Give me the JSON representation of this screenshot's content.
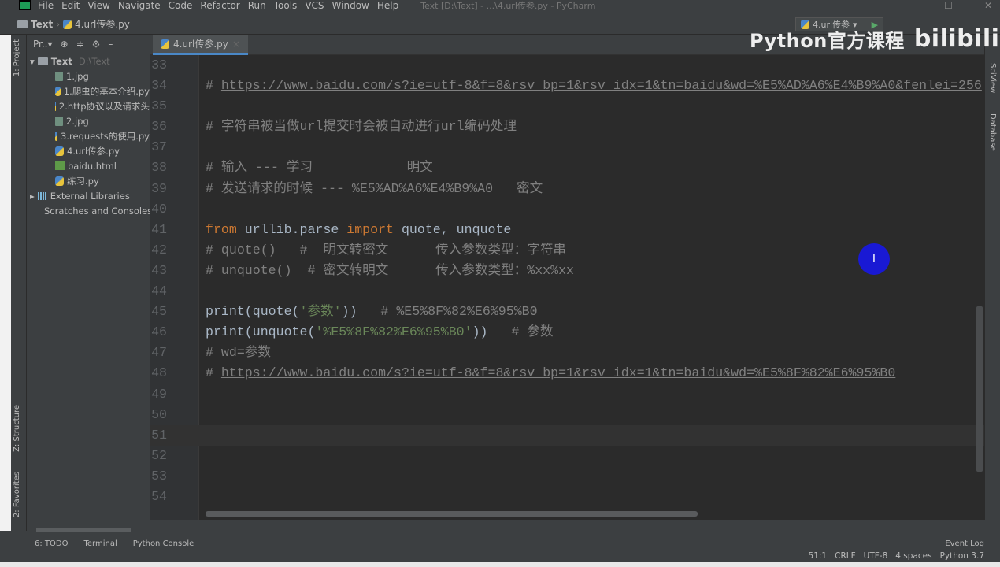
{
  "menu": [
    "File",
    "Edit",
    "View",
    "Navigate",
    "Code",
    "Refactor",
    "Run",
    "Tools",
    "VCS",
    "Window",
    "Help"
  ],
  "window_title": "Text [D:\\Text] - ...\\4.url传参.py - PyCharm",
  "breadcrumb": {
    "project": "Text",
    "file": "4.url传参.py"
  },
  "run_config": "4.url传参",
  "watermark": {
    "text": "Python官方课程",
    "logo": "bilibili"
  },
  "project_panel": {
    "dropdown": "Pr..",
    "root": "Text",
    "root_path": "D:\\Text",
    "files": [
      "1.jpg",
      "1.爬虫的基本介绍.py",
      "2.http协议以及请求头",
      "2.jpg",
      "3.requests的使用.py",
      "4.url传参.py",
      "baidu.html",
      "练习.py"
    ],
    "external": "External Libraries",
    "scratches": "Scratches and Consoles"
  },
  "side_tabs": {
    "project": "1: Project",
    "structure": "Z: Structure",
    "favorites": "2: Favorites"
  },
  "editor_tab": "4.url传参.py",
  "lines": [
    {
      "n": "33",
      "t": []
    },
    {
      "n": "34",
      "t": [
        [
          "c",
          "# "
        ],
        [
          "u",
          "https://www.baidu.com/s?ie=utf-8&f=8&rsv_bp=1&rsv_idx=1&tn=baidu&wd=%E5%AD%A6%E4%B9%A0&fenlei=256"
        ]
      ]
    },
    {
      "n": "35",
      "t": []
    },
    {
      "n": "36",
      "t": [
        [
          "c",
          "# 字符串被当做url提交时会被自动进行url编码处理"
        ]
      ]
    },
    {
      "n": "37",
      "t": []
    },
    {
      "n": "38",
      "t": [
        [
          "c",
          "# 输入 --- 学习            明文"
        ]
      ]
    },
    {
      "n": "39",
      "t": [
        [
          "c",
          "# 发送请求的时候 --- %E5%AD%A6%E4%B9%A0   密文"
        ]
      ]
    },
    {
      "n": "40",
      "t": []
    },
    {
      "n": "41",
      "t": [
        [
          "k",
          "from"
        ],
        [
          "p",
          " urllib.parse "
        ],
        [
          "k",
          "import"
        ],
        [
          "p",
          " quote, unquote"
        ]
      ]
    },
    {
      "n": "42",
      "t": [
        [
          "c",
          "# quote()   #  明文转密文      传入参数类型：字符串"
        ]
      ]
    },
    {
      "n": "43",
      "t": [
        [
          "c",
          "# unquote()  # 密文转明文      传入参数类型：%xx%xx"
        ]
      ]
    },
    {
      "n": "44",
      "t": []
    },
    {
      "n": "45",
      "t": [
        [
          "p",
          "print(quote("
        ],
        [
          "s",
          "'参数'"
        ],
        [
          "p",
          "))   "
        ],
        [
          "c",
          "# %E5%8F%82%E6%95%B0"
        ]
      ]
    },
    {
      "n": "46",
      "t": [
        [
          "p",
          "print(unquote("
        ],
        [
          "s",
          "'%E5%8F%82%E6%95%B0'"
        ],
        [
          "p",
          "))   "
        ],
        [
          "c",
          "# 参数"
        ]
      ]
    },
    {
      "n": "47",
      "t": [
        [
          "c",
          "# wd=参数"
        ]
      ]
    },
    {
      "n": "48",
      "t": [
        [
          "c",
          "# "
        ],
        [
          "u",
          "https://www.baidu.com/s?ie=utf-8&f=8&rsv_bp=1&rsv_idx=1&tn=baidu&wd=%E5%8F%82%E6%95%B0"
        ]
      ]
    },
    {
      "n": "49",
      "t": []
    },
    {
      "n": "50",
      "t": []
    },
    {
      "n": "51",
      "t": []
    },
    {
      "n": "52",
      "t": []
    },
    {
      "n": "53",
      "t": []
    },
    {
      "n": "54",
      "t": []
    }
  ],
  "current_line": "51",
  "right_tabs": [
    "SciView",
    "Database"
  ],
  "bottom_tools": [
    "6: TODO",
    "Terminal",
    "Python Console"
  ],
  "event_log": "Event Log",
  "status": [
    "51:1",
    "CRLF",
    "UTF-8",
    "4 spaces",
    "Python 3.7"
  ]
}
